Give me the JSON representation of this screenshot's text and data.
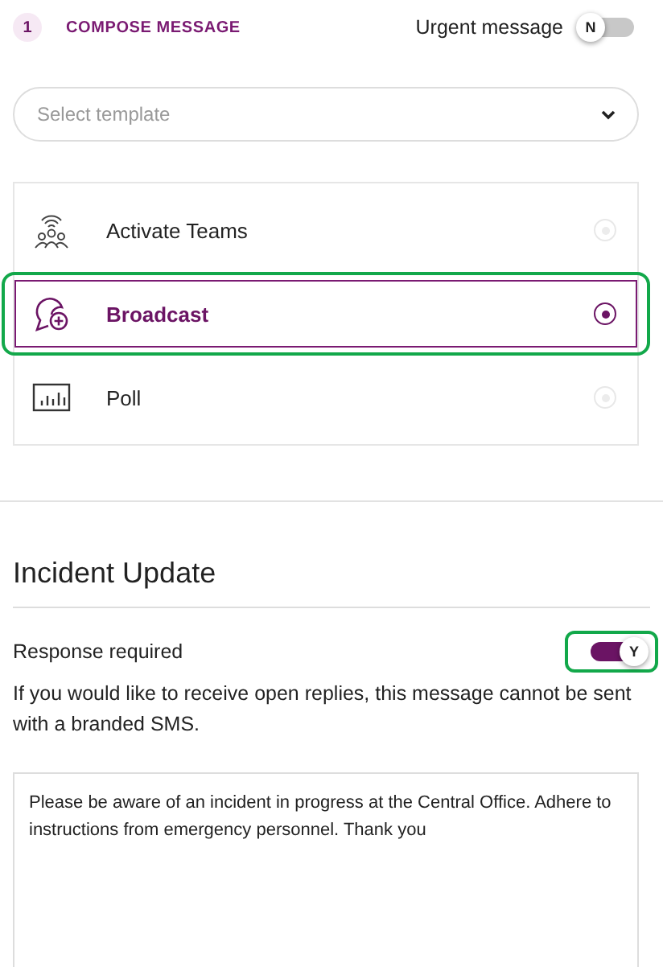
{
  "step": {
    "number": "1",
    "title": "COMPOSE MESSAGE"
  },
  "urgent": {
    "label": "Urgent message",
    "on": false,
    "knob_label": "N",
    "highlighted": false
  },
  "template_select": {
    "placeholder": "Select template"
  },
  "options": [
    {
      "kind": "teams",
      "label": "Activate Teams",
      "selected": false,
      "highlighted": false
    },
    {
      "kind": "broadcast",
      "label": "Broadcast",
      "selected": true,
      "highlighted": true
    },
    {
      "kind": "poll",
      "label": "Poll",
      "selected": false,
      "highlighted": false
    }
  ],
  "section_title": "Incident Update",
  "response": {
    "label": "Response required",
    "on": true,
    "knob_label": "Y",
    "highlighted": true
  },
  "note": "If you would like to receive open replies, this message cannot be sent with a branded SMS.",
  "message": {
    "value": "Please be aware of an incident in progress at the Central Office. Adhere to instructions from emergency personnel. Thank you"
  }
}
